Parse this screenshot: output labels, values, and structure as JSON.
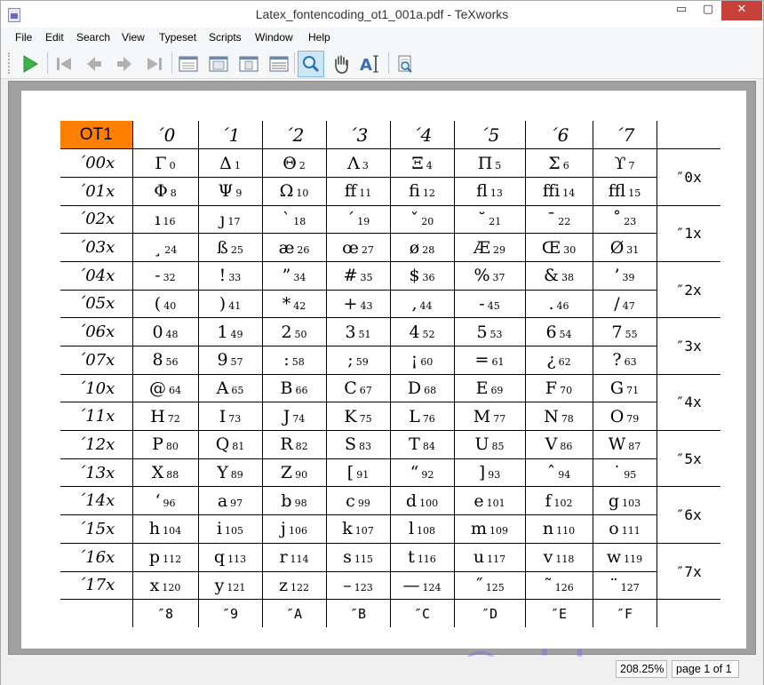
{
  "window": {
    "title": "Latex_fontencoding_ot1_001a.pdf - TeXworks",
    "minimize": "▭",
    "maximize": "▢",
    "close": "✕"
  },
  "menu": [
    {
      "id": "file",
      "label": "File"
    },
    {
      "id": "edit",
      "label": "Edit"
    },
    {
      "id": "search",
      "label": "Search"
    },
    {
      "id": "view",
      "label": "View"
    },
    {
      "id": "typeset",
      "label": "Typeset"
    },
    {
      "id": "scripts",
      "label": "Scripts"
    },
    {
      "id": "window",
      "label": "Window"
    },
    {
      "id": "help",
      "label": "Help"
    }
  ],
  "toolbar": [
    {
      "name": "typeset-icon",
      "active": false
    },
    {
      "name": "first-page-icon",
      "active": false
    },
    {
      "name": "previous-page-icon",
      "active": false
    },
    {
      "name": "next-page-icon",
      "active": false
    },
    {
      "name": "last-page-icon",
      "active": false
    },
    {
      "name": "actual-size-icon",
      "active": false
    },
    {
      "name": "fit-width-icon",
      "active": false
    },
    {
      "name": "fit-page-icon",
      "active": false
    },
    {
      "name": "fit-content-icon",
      "active": false
    },
    {
      "name": "magnifier-icon",
      "active": true
    },
    {
      "name": "hand-tool-icon",
      "active": false
    },
    {
      "name": "select-text-icon",
      "active": false
    },
    {
      "name": "go-to-source-icon",
      "active": false
    }
  ],
  "table": {
    "corner": "OT1",
    "col_headers": [
      "´0",
      "´1",
      "´2",
      "´3",
      "´4",
      "´5",
      "´6",
      "´7"
    ],
    "row_headers": [
      "´00x",
      "´01x",
      "´02x",
      "´03x",
      "´04x",
      "´05x",
      "´06x",
      "´07x",
      "´10x",
      "´11x",
      "´12x",
      "´13x",
      "´14x",
      "´15x",
      "´16x",
      "´17x"
    ],
    "group_headers": [
      "″0x",
      "″1x",
      "″2x",
      "″3x",
      "″4x",
      "″5x",
      "″6x",
      "″7x"
    ],
    "footer": [
      "″8",
      "″9",
      "″A",
      "″B",
      "″C",
      "″D",
      "″E",
      "″F"
    ],
    "cells": [
      [
        [
          "Γ",
          "0"
        ],
        [
          "Δ",
          "1"
        ],
        [
          "Θ",
          "2"
        ],
        [
          "Λ",
          "3"
        ],
        [
          "Ξ",
          "4"
        ],
        [
          "Π",
          "5"
        ],
        [
          "Σ",
          "6"
        ],
        [
          "ϒ",
          "7"
        ]
      ],
      [
        [
          "Φ",
          "8"
        ],
        [
          "Ψ",
          "9"
        ],
        [
          "Ω",
          "10"
        ],
        [
          "ff",
          "11"
        ],
        [
          "fi",
          "12"
        ],
        [
          "fl",
          "13"
        ],
        [
          "ffi",
          "14"
        ],
        [
          "ffl",
          "15"
        ]
      ],
      [
        [
          "ı",
          "16"
        ],
        [
          "ȷ",
          "17"
        ],
        [
          "`",
          "18"
        ],
        [
          "´",
          "19"
        ],
        [
          "ˇ",
          "20"
        ],
        [
          "˘",
          "21"
        ],
        [
          "¯",
          "22"
        ],
        [
          "˚",
          "23"
        ]
      ],
      [
        [
          "¸",
          "24"
        ],
        [
          "ß",
          "25"
        ],
        [
          "æ",
          "26"
        ],
        [
          "œ",
          "27"
        ],
        [
          "ø",
          "28"
        ],
        [
          "Æ",
          "29"
        ],
        [
          "Œ",
          "30"
        ],
        [
          "Ø",
          "31"
        ]
      ],
      [
        [
          "˗",
          "32"
        ],
        [
          "!",
          "33"
        ],
        [
          "”",
          "34"
        ],
        [
          "#",
          "35"
        ],
        [
          "$",
          "36"
        ],
        [
          "%",
          "37"
        ],
        [
          "&",
          "38"
        ],
        [
          "’",
          "39"
        ]
      ],
      [
        [
          "(",
          "40"
        ],
        [
          ")",
          "41"
        ],
        [
          "*",
          "42"
        ],
        [
          "+",
          "43"
        ],
        [
          ",",
          "44"
        ],
        [
          "-",
          "45"
        ],
        [
          ".",
          "46"
        ],
        [
          "/",
          "47"
        ]
      ],
      [
        [
          "0",
          "48"
        ],
        [
          "1",
          "49"
        ],
        [
          "2",
          "50"
        ],
        [
          "3",
          "51"
        ],
        [
          "4",
          "52"
        ],
        [
          "5",
          "53"
        ],
        [
          "6",
          "54"
        ],
        [
          "7",
          "55"
        ]
      ],
      [
        [
          "8",
          "56"
        ],
        [
          "9",
          "57"
        ],
        [
          ":",
          "58"
        ],
        [
          ";",
          "59"
        ],
        [
          "¡",
          "60"
        ],
        [
          "=",
          "61"
        ],
        [
          "¿",
          "62"
        ],
        [
          "?",
          "63"
        ]
      ],
      [
        [
          "@",
          "64"
        ],
        [
          "A",
          "65"
        ],
        [
          "B",
          "66"
        ],
        [
          "C",
          "67"
        ],
        [
          "D",
          "68"
        ],
        [
          "E",
          "69"
        ],
        [
          "F",
          "70"
        ],
        [
          "G",
          "71"
        ]
      ],
      [
        [
          "H",
          "72"
        ],
        [
          "I",
          "73"
        ],
        [
          "J",
          "74"
        ],
        [
          "K",
          "75"
        ],
        [
          "L",
          "76"
        ],
        [
          "M",
          "77"
        ],
        [
          "N",
          "78"
        ],
        [
          "O",
          "79"
        ]
      ],
      [
        [
          "P",
          "80"
        ],
        [
          "Q",
          "81"
        ],
        [
          "R",
          "82"
        ],
        [
          "S",
          "83"
        ],
        [
          "T",
          "84"
        ],
        [
          "U",
          "85"
        ],
        [
          "V",
          "86"
        ],
        [
          "W",
          "87"
        ]
      ],
      [
        [
          "X",
          "88"
        ],
        [
          "Y",
          "89"
        ],
        [
          "Z",
          "90"
        ],
        [
          "[",
          "91"
        ],
        [
          "“",
          "92"
        ],
        [
          "]",
          "93"
        ],
        [
          "ˆ",
          "94"
        ],
        [
          "˙",
          "95"
        ]
      ],
      [
        [
          "‘",
          "96"
        ],
        [
          "a",
          "97"
        ],
        [
          "b",
          "98"
        ],
        [
          "c",
          "99"
        ],
        [
          "d",
          "100"
        ],
        [
          "e",
          "101"
        ],
        [
          "f",
          "102"
        ],
        [
          "g",
          "103"
        ]
      ],
      [
        [
          "h",
          "104"
        ],
        [
          "i",
          "105"
        ],
        [
          "j",
          "106"
        ],
        [
          "k",
          "107"
        ],
        [
          "l",
          "108"
        ],
        [
          "m",
          "109"
        ],
        [
          "n",
          "110"
        ],
        [
          "o",
          "111"
        ]
      ],
      [
        [
          "p",
          "112"
        ],
        [
          "q",
          "113"
        ],
        [
          "r",
          "114"
        ],
        [
          "s",
          "115"
        ],
        [
          "t",
          "116"
        ],
        [
          "u",
          "117"
        ],
        [
          "v",
          "118"
        ],
        [
          "w",
          "119"
        ]
      ],
      [
        [
          "x",
          "120"
        ],
        [
          "y",
          "121"
        ],
        [
          "z",
          "122"
        ],
        [
          "–",
          "123"
        ],
        [
          "—",
          "124"
        ],
        [
          "˝",
          "125"
        ],
        [
          "˜",
          "126"
        ],
        [
          "¨",
          "127"
        ]
      ]
    ]
  },
  "watermark": "©sideway",
  "status": {
    "zoom": "208.25%",
    "page": "page 1 of 1"
  }
}
